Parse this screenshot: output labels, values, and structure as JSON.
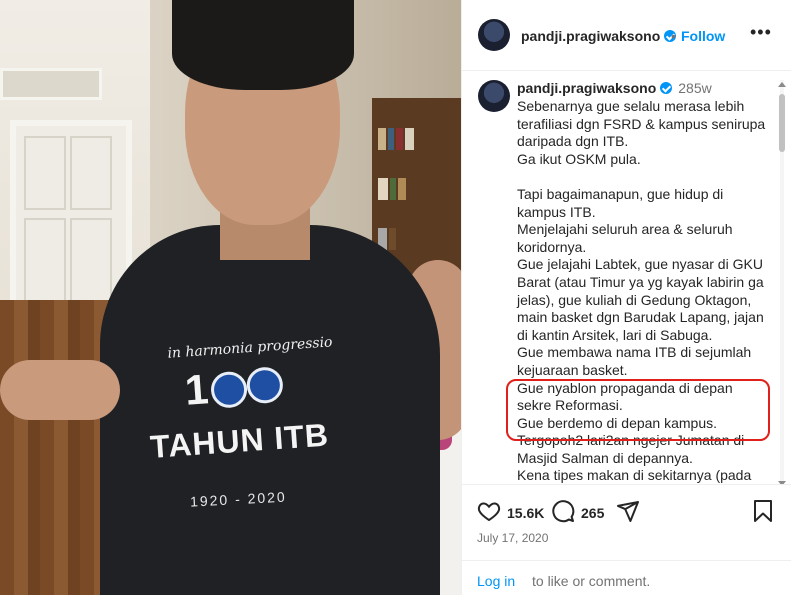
{
  "post": {
    "username": "pandji.pragiwaksono",
    "follow_label": "Follow",
    "separator": "•",
    "more_icon": "more-horizontal-icon",
    "time_ago": "285w",
    "caption_lines": [
      "Sebenarnya gue selalu merasa lebih",
      "terafiliasi dgn FSRD & kampus senirupa",
      "daripada dgn ITB.",
      "Ga ikut OSKM pula.",
      "",
      "Tapi bagaimanapun, gue hidup di",
      "kampus ITB.",
      "Menjelajahi seluruh area & seluruh",
      "koridornya.",
      "Gue jelajahi Labtek, gue nyasar di GKU",
      "Barat (atau Timur ya yg kayak labirin ga",
      "jelas), gue kuliah di Gedung Oktagon,",
      "main basket dgn Barudak Lapang, jajan",
      "di kantin Arsitek, lari di Sabuga.",
      "Gue membawa nama ITB di sejumlah",
      "kejuaraan basket.",
      "Gue nyablon propaganda di depan",
      "sekre Reformasi.",
      "Gue berdemo di depan kampus.",
      "Tergopoh2 lari2an ngejer Jumatan di",
      "Masjid Salman di depannya.",
      "Kena tipes makan di sekitarnya (pada"
    ],
    "likes": "15.6K",
    "comments": "265",
    "date": "July 17, 2020",
    "login_label": "Log in",
    "login_rest": " to like or comment.",
    "colors": {
      "accent": "#0095f6",
      "highlight": "#e0201b",
      "text": "#262626",
      "muted": "#737373"
    }
  },
  "photo": {
    "shirt_motto": "in harmonia progressio",
    "shirt_number": "100",
    "shirt_title": "TAHUN ITB",
    "shirt_years": "1920 - 2020"
  }
}
